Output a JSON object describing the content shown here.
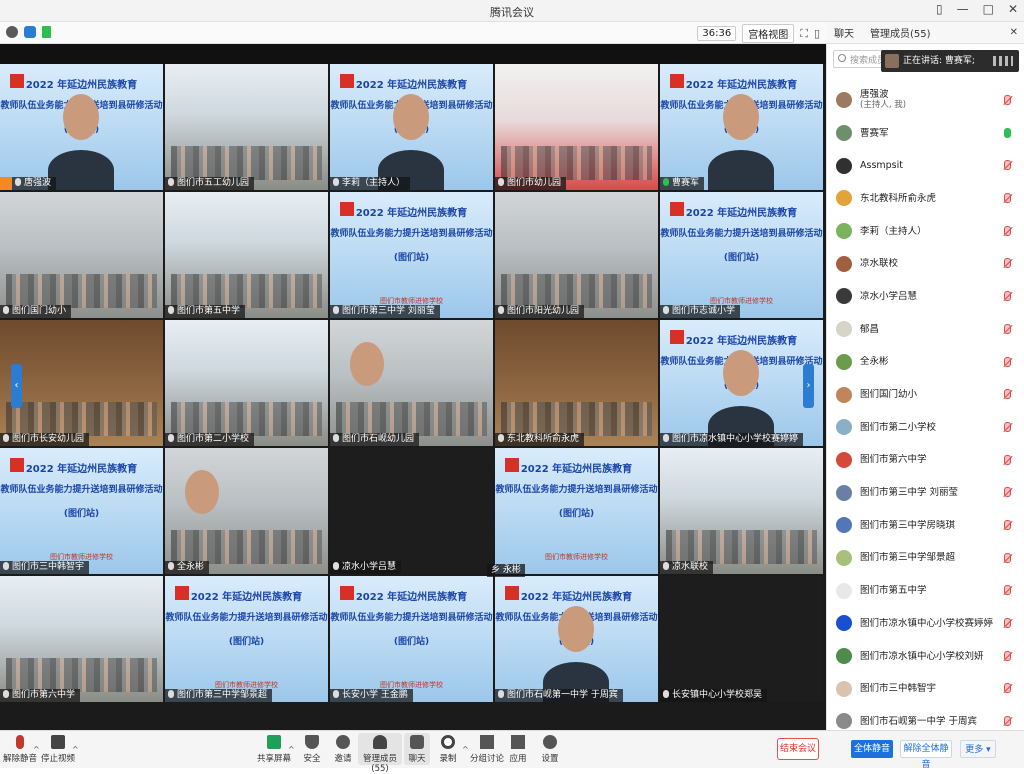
{
  "window": {
    "title": "腾讯会议",
    "controls": [
      "▯",
      "—",
      "□",
      "✕"
    ]
  },
  "toolbar": {
    "timer": "36:36",
    "view_label": "宫格视图"
  },
  "panel_tabs": {
    "chat": "聊天",
    "members": "管理成员(55)",
    "close": "✕"
  },
  "panel": {
    "search_placeholder": "搜索成员",
    "speaking": "正在讲话: 曹赛军;"
  },
  "slide_text": {
    "line1": "2022 年延边州民族教育",
    "line2": "教师队伍业务能力提升送培到县研修活动",
    "line3": "(图们站)",
    "line4": "图们市教师进修学校"
  },
  "tiles": [
    {
      "label": "唐强波",
      "kind": "slide",
      "host": true
    },
    {
      "label": "图们市五工幼儿园",
      "kind": "cls"
    },
    {
      "label": "李莉（主持人）",
      "kind": "slide"
    },
    {
      "label": "图们市幼儿园",
      "kind": "red"
    },
    {
      "label": "曹赛军",
      "kind": "slide",
      "speaking": true
    },
    {
      "label": "图们国门幼小",
      "kind": "room"
    },
    {
      "label": "图们市第五中学",
      "kind": "cls"
    },
    {
      "label": "图们市第三中学 刘丽莹",
      "kind": "slide"
    },
    {
      "label": "图们市阳光幼儿园",
      "kind": "room"
    },
    {
      "label": "图们市志诚小学",
      "kind": "slide"
    },
    {
      "label": "图们市长安幼儿园",
      "kind": "wood"
    },
    {
      "label": "图们市第二小学校",
      "kind": "cls"
    },
    {
      "label": "图们市石岘幼儿园",
      "kind": "room"
    },
    {
      "label": "东北教科所俞永虎",
      "kind": "wood"
    },
    {
      "label": "图们市凉水镇中心小学校赛婷婷",
      "kind": "slide"
    },
    {
      "label": "图们市三中韩智宇",
      "kind": "slide"
    },
    {
      "label": "全永彬",
      "kind": "room"
    },
    {
      "label": "凉水小学吕慧",
      "kind": "dark"
    },
    {
      "label": "",
      "kind": "slide"
    },
    {
      "label": "凉水联校",
      "kind": "cls"
    },
    {
      "label": "图们市第六中学",
      "kind": "cls"
    },
    {
      "label": "图们市第三中学邹景超",
      "kind": "slide"
    },
    {
      "label": "长安小学 王金鹏",
      "kind": "slide"
    },
    {
      "label": "图们市石岘第一中学  于周宾",
      "kind": "slide"
    },
    {
      "label": "长安镇中心小学校郑吴",
      "kind": "dark"
    }
  ],
  "floating_name": "乡 永彬",
  "members": [
    {
      "name": "唐强波",
      "sub": "(主持人, 我)",
      "color": "#9c7a60",
      "mic": "muted"
    },
    {
      "name": "曹赛军",
      "sub": "",
      "color": "#6e8f6b",
      "mic": "on"
    },
    {
      "name": "Assmpsit",
      "sub": "",
      "color": "#303030",
      "mic": "muted"
    },
    {
      "name": "东北教科所俞永虎",
      "sub": "",
      "color": "#e2a33a",
      "mic": "muted"
    },
    {
      "name": "李莉（主持人）",
      "sub": "",
      "color": "#7bb35c",
      "mic": "muted"
    },
    {
      "name": "凉水联校",
      "sub": "",
      "color": "#a06040",
      "mic": "muted"
    },
    {
      "name": "凉水小学吕慧",
      "sub": "",
      "color": "#3a3a3a",
      "mic": "muted"
    },
    {
      "name": "郁昌",
      "sub": "",
      "color": "#d7d4c8",
      "mic": "muted"
    },
    {
      "name": "全永彬",
      "sub": "",
      "color": "#6a9c4b",
      "mic": "muted"
    },
    {
      "name": "图们国门幼小",
      "sub": "",
      "color": "#c0855a",
      "mic": "muted"
    },
    {
      "name": "图们市第二小学校",
      "sub": "",
      "color": "#8ab0c8",
      "mic": "muted"
    },
    {
      "name": "图们市第六中学",
      "sub": "",
      "color": "#d34a3a",
      "mic": "muted"
    },
    {
      "name": "图们市第三中学 刘丽莹",
      "sub": "",
      "color": "#6a7fa3",
      "mic": "muted"
    },
    {
      "name": "图们市第三中学房晓琪",
      "sub": "",
      "color": "#5277b8",
      "mic": "muted"
    },
    {
      "name": "图们市第三中学邹景超",
      "sub": "",
      "color": "#a9c07a",
      "mic": "muted"
    },
    {
      "name": "图们市第五中学",
      "sub": "",
      "color": "#e8e8e8",
      "mic": "muted"
    },
    {
      "name": "图们市凉水镇中心小学校赛婷婷",
      "sub": "",
      "color": "#1a4fd1",
      "mic": "muted"
    },
    {
      "name": "图们市凉水镇中心小学校刘妍",
      "sub": "",
      "color": "#4d8c4a",
      "mic": "muted"
    },
    {
      "name": "图们市三中韩智宇",
      "sub": "",
      "color": "#d9c3b0",
      "mic": "muted"
    },
    {
      "name": "图们市石岘第一中学  于周宾",
      "sub": "",
      "color": "#8a8a8a",
      "mic": "muted"
    }
  ],
  "bottombar": {
    "unmute": "解除静音",
    "stop_video": "停止视频",
    "share_screen": "共享屏幕",
    "security": "安全",
    "invite": "邀请",
    "manage_members": "管理成员(55)",
    "chat": "聊天",
    "record": "录制",
    "breakout": "分组讨论",
    "apps": "应用",
    "settings": "设置",
    "end_meeting": "结束会议",
    "mute_all": "全体静音",
    "unmute_all": "解除全体静音",
    "more": "更多 ▾"
  }
}
